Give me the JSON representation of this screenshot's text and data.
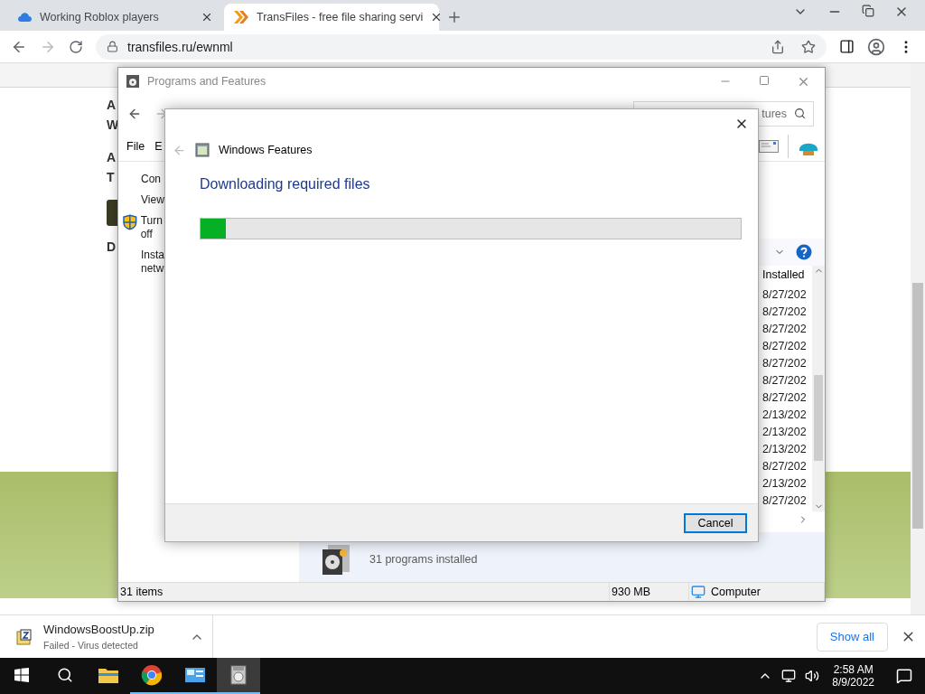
{
  "browser": {
    "tabs": [
      {
        "title": "Working Roblox players",
        "selected": false
      },
      {
        "title": "TransFiles - free file sharing servi",
        "selected": true
      }
    ],
    "url": "transfiles.ru/ewnml"
  },
  "page": {
    "fragments": [
      "A",
      "W",
      "A",
      "T",
      "D"
    ]
  },
  "programs_window": {
    "title": "Programs and Features",
    "search_placeholder": "tures",
    "menu": [
      "File",
      "E"
    ],
    "tasks": [
      {
        "label": "Con",
        "kind": "plain"
      },
      {
        "label": "View",
        "kind": "plain"
      },
      {
        "label": "Turn off",
        "kind": "shield"
      },
      {
        "label": "Insta netw",
        "kind": "plain"
      }
    ],
    "column": "Installed",
    "dates": [
      "8/27/202",
      "8/27/202",
      "8/27/202",
      "8/27/202",
      "8/27/202",
      "8/27/202",
      "8/27/202",
      "2/13/202",
      "2/13/202",
      "2/13/202",
      "8/27/202",
      "2/13/202",
      "8/27/202"
    ],
    "details": {
      "count": "31 programs installed"
    },
    "status": {
      "items": "31 items",
      "size": "930 MB",
      "location": "Computer"
    }
  },
  "dialog": {
    "title": "Windows Features",
    "heading": "Downloading required files",
    "progress": {
      "level": 0.047
    },
    "cancel": "Cancel"
  },
  "download": {
    "file": "WindowsBoostUp.zip",
    "status": "Failed - Virus detected",
    "show_all": "Show all"
  },
  "taskbar": {
    "apps": [
      {
        "kind": "explorer",
        "running": false,
        "selected": false
      },
      {
        "kind": "chrome",
        "running": true,
        "selected": false
      },
      {
        "kind": "control",
        "running": true,
        "selected": false
      },
      {
        "kind": "programs",
        "running": true,
        "selected": true
      }
    ],
    "time": "2:58 AM",
    "date": "8/9/2022"
  }
}
